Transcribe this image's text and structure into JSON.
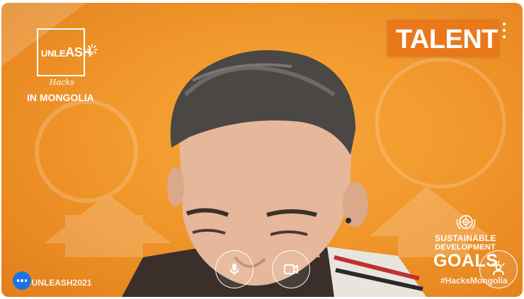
{
  "overlay": {
    "logo": {
      "word_prefix": "UNLE",
      "word_suffix": "ASH",
      "hacks": "Hacks",
      "location": "IN MONGOLIA"
    },
    "talent_label": "TALENT",
    "sdg": {
      "line1": "SUSTAINABLE",
      "line2": "DEVELOPMENT",
      "goals": "GOALS",
      "tag": "#HacksMongolia"
    },
    "hashtag": "#UNLEASH2021"
  },
  "controls": {
    "mic_icon": "microphone-icon",
    "camera_icon": "video-camera-icon",
    "effects_icon": "person-effects-icon",
    "more_icon": "more-options-icon",
    "menu_icon": "vertical-dots-icon"
  },
  "colors": {
    "background_orange": "#f29a2e",
    "banner_orange": "#e9781a",
    "more_button_blue": "#1a73e8",
    "overlay_white": "#ffffff"
  }
}
